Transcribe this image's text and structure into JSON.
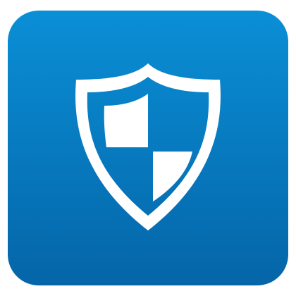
{
  "icon": {
    "name": "shield-icon",
    "colors": {
      "gradient_top": "#0a8fd6",
      "gradient_bottom": "#0565a8",
      "emblem": "#ffffff"
    }
  }
}
